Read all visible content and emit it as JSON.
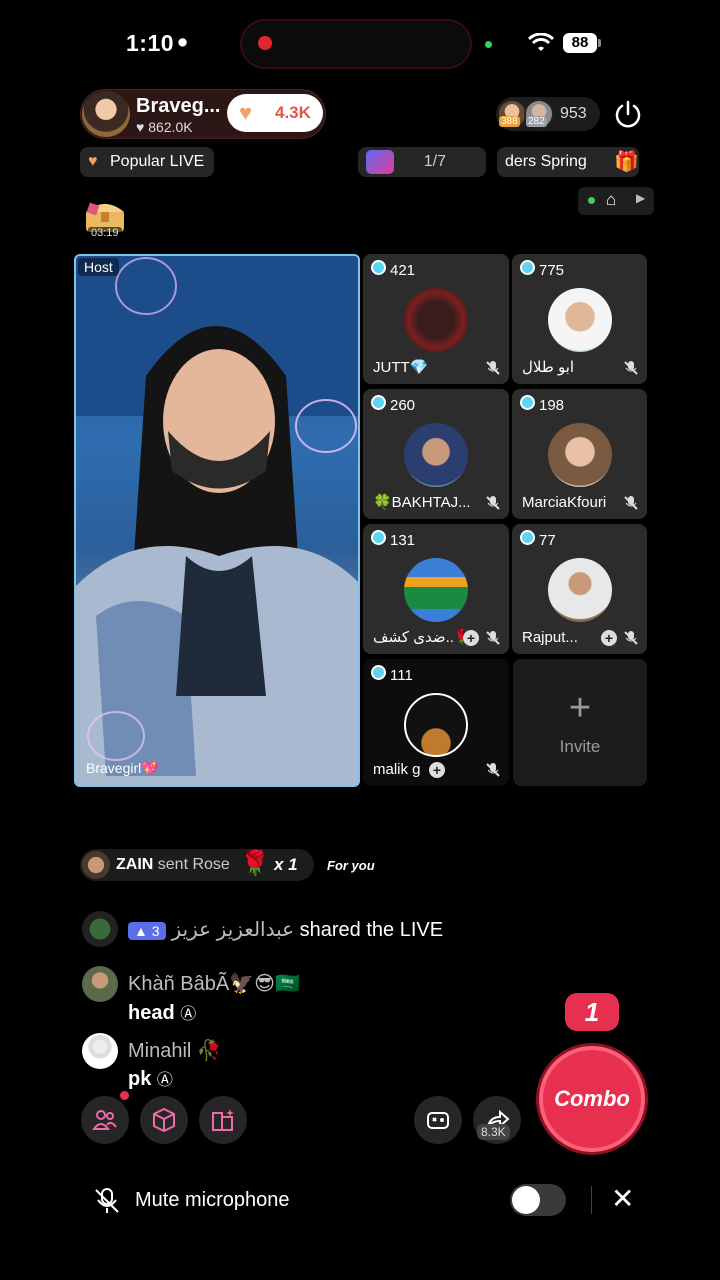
{
  "status_bar": {
    "time": "1:10",
    "battery": "88"
  },
  "host": {
    "name": "Braveg...",
    "likes": "862.0K",
    "like_button": "4.3K",
    "viewer_badges": [
      "388",
      "282"
    ],
    "viewer_count": "953"
  },
  "tags": {
    "popular": "Popular LIVE",
    "page": "1/7",
    "spring": "ders   Spring"
  },
  "chest": {
    "timer": "03:19"
  },
  "stage": {
    "host_label": "Host",
    "host_name": "Bravegirl💖",
    "guests": [
      {
        "count": "421",
        "name": "JUTT💎"
      },
      {
        "count": "775",
        "name": "ابو طلال"
      },
      {
        "count": "260",
        "name": "🍀BAKHTAJ..."
      },
      {
        "count": "198",
        "name": "MarciaKfouri"
      },
      {
        "count": "131",
        "name": "ضدى كشف..🌹"
      },
      {
        "count": "77",
        "name": "Rajput..."
      },
      {
        "count": "111",
        "name": "malik g"
      }
    ],
    "invite_label": "Invite"
  },
  "gift_notice": {
    "user": "ZAIN",
    "text": "sent Rose",
    "multiplier": "x 1",
    "for_you": "For you"
  },
  "chat": [
    {
      "name": "عبدالعزيز عزيز",
      "level": "3",
      "message": "shared the LIVE"
    },
    {
      "name": "Khàñ BâbÃ🦅😎🇸🇦",
      "message": "head"
    },
    {
      "name": "Minahil 🥀",
      "message": "pk"
    }
  ],
  "combo": {
    "count": "1",
    "label": "Combo"
  },
  "toolbar": {
    "share_count": "8.3K"
  },
  "mute": {
    "label": "Mute microphone"
  },
  "colors": {
    "accent": "#e7304f",
    "tile": "#2c2c2c",
    "badge": "#5cd4f3"
  }
}
